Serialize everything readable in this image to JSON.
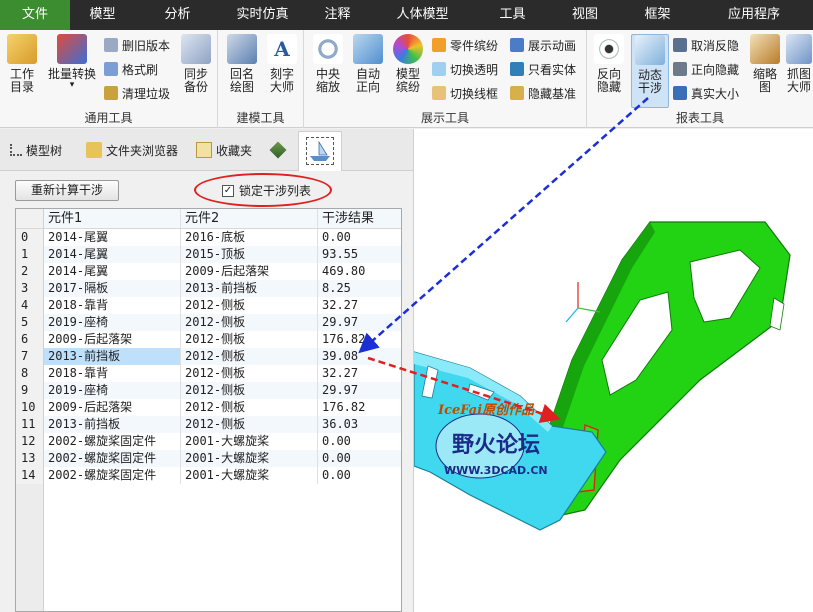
{
  "menu": {
    "tabs": [
      {
        "label": "文件",
        "active": true
      },
      {
        "label": "模型"
      },
      {
        "label": "分析"
      },
      {
        "label": "实时仿真"
      },
      {
        "label": "注释"
      },
      {
        "label": "人体模型"
      },
      {
        "label": "工具"
      },
      {
        "label": "视图"
      },
      {
        "label": "框架"
      },
      {
        "label": "应用程序"
      }
    ]
  },
  "ribbon": {
    "general": {
      "label": "通用工具",
      "work_dir": "工作目录",
      "batch_convert": "批量转换",
      "delete_old": "删旧版本",
      "format_brush": "格式刷",
      "clean_trash": "清理垃圾",
      "sync_backup": "同步备份"
    },
    "modeling": {
      "label": "建模工具",
      "back_draw": "回名绘图",
      "engrave": "刻字大师"
    },
    "display": {
      "label": "展示工具",
      "center_zoom": "中央缩放",
      "auto_front": "自动正向",
      "model_color": "模型缤纷",
      "part_color": "零件缤纷",
      "toggle_transparent": "切换透明",
      "toggle_wireframe": "切换线框",
      "show_anim": "展示动画",
      "only_solid": "只看实体",
      "hide_datum": "隐藏基准"
    },
    "report": {
      "label": "报表工具",
      "reverse_hide": "反向隐藏",
      "dynamic_interference": "动态干涉",
      "cancel_reverse_hide": "取消反隐",
      "forward_hide": "正向隐藏",
      "real_size": "真实大小",
      "thumbnail": "缩略图",
      "grab_master": "抓图大师"
    }
  },
  "panel": {
    "tabs": {
      "model_tree": "模型树",
      "folder_browser": "文件夹浏览器",
      "favorites": "收藏夹"
    },
    "recalc_button": "重新计算干涉",
    "lock_checkbox": {
      "label": "锁定干涉列表",
      "checked": true,
      "check_mark": "✓"
    }
  },
  "table": {
    "headers": [
      "",
      "元件1",
      "元件2",
      "干涉结果"
    ],
    "selected_row": 7,
    "rows": [
      [
        "0",
        "2014-尾翼",
        "2016-底板",
        "0.00"
      ],
      [
        "1",
        "2014-尾翼",
        "2015-顶板",
        "93.55"
      ],
      [
        "2",
        "2014-尾翼",
        "2009-后起落架",
        "469.80"
      ],
      [
        "3",
        "2017-隔板",
        "2013-前挡板",
        "8.25"
      ],
      [
        "4",
        "2018-靠背",
        "2012-侧板",
        "32.27"
      ],
      [
        "5",
        "2019-座椅",
        "2012-侧板",
        "29.97"
      ],
      [
        "6",
        "2009-后起落架",
        "2012-侧板",
        "176.82"
      ],
      [
        "7",
        "2013-前挡板",
        "2012-侧板",
        "39.08"
      ],
      [
        "8",
        "2018-靠背",
        "2012-侧板",
        "32.27"
      ],
      [
        "9",
        "2019-座椅",
        "2012-侧板",
        "29.97"
      ],
      [
        "10",
        "2009-后起落架",
        "2012-侧板",
        "176.82"
      ],
      [
        "11",
        "2013-前挡板",
        "2012-侧板",
        "36.03"
      ],
      [
        "12",
        "2002-螺旋桨固定件",
        "2001-大螺旋桨",
        "0.00"
      ],
      [
        "13",
        "2002-螺旋桨固定件",
        "2001-大螺旋桨",
        "0.00"
      ],
      [
        "14",
        "2002-螺旋桨固定件",
        "2001-大螺旋桨",
        "0.00"
      ]
    ]
  },
  "watermark": {
    "line1": "IceFai原创作品",
    "line2": "野火论坛",
    "line3": "WWW.3DCAD.CN"
  },
  "colors": {
    "menu_active": "#3c8d2f",
    "menu_bg": "#2b2b2b",
    "part_green": "#22d314",
    "part_cyan": "#3fd8ef",
    "interference_red": "#e02020",
    "arrow_blue": "#1c2fd6"
  }
}
